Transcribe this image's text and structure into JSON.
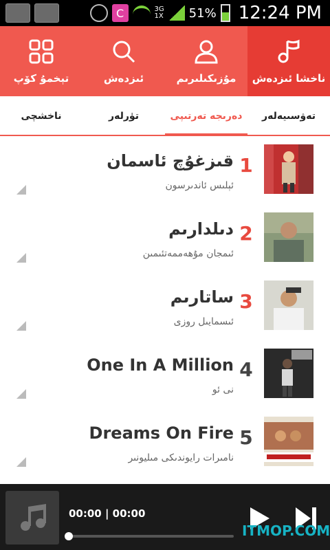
{
  "status_bar": {
    "network_top": "3G",
    "network_bottom": "1X",
    "battery": "51%",
    "time": "12:24 PM",
    "c_app_letter": "C"
  },
  "top_nav": {
    "items": [
      {
        "label": "تېخمۇ كۆپ",
        "icon": "grid-icon"
      },
      {
        "label": "ئىزدەش",
        "icon": "search-icon"
      },
      {
        "label": "مۇزىكىلىرىم",
        "icon": "user-icon"
      },
      {
        "label": "ناخشا ئىزدەش",
        "icon": "music-note-icon"
      }
    ]
  },
  "tabs": [
    {
      "label": "ناخشچى"
    },
    {
      "label": "تۈرلەر"
    },
    {
      "label": "دەرىجە تەرتىپى"
    },
    {
      "label": "تەۋسىيەلەر"
    }
  ],
  "songs": [
    {
      "rank": "1",
      "title": "قىزغۇچ ئاسمان",
      "artist": "ئېلىس ئاندىرسون",
      "rank_color": "#e84a3f"
    },
    {
      "rank": "2",
      "title": "دىلدارىم",
      "artist": "ئىمجان مۇھەممەتئىمىن",
      "rank_color": "#e84a3f"
    },
    {
      "rank": "3",
      "title": "ساتارىم",
      "artist": "ئىسمايىل روزى",
      "rank_color": "#e84a3f"
    },
    {
      "rank": "4",
      "title": "One In A Million",
      "artist": "نى ئو",
      "rank_color": "#444444"
    },
    {
      "rank": "5",
      "title": "Dreams On Fire",
      "artist": "نامىرات رايوندىكى مىليونىر",
      "rank_color": "#444444"
    }
  ],
  "player": {
    "time": "00:00 | 00:00",
    "progress": 0.0
  },
  "watermark": "ITMOP.COM",
  "colors": {
    "accent": "#f0594f",
    "accent_dark": "#e63c34"
  }
}
